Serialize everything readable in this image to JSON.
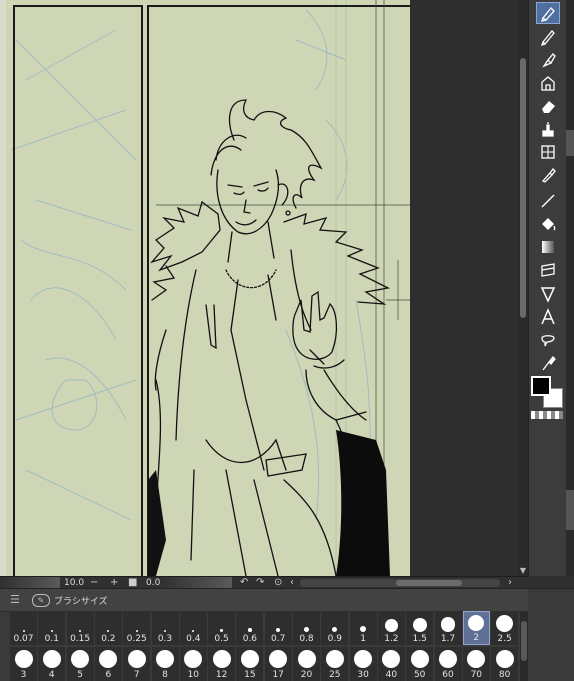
{
  "statusbar": {
    "zoom_value": "10.0",
    "minus_label": "−",
    "plus_label": "+",
    "rotation_value": "0.0",
    "left_arrow": "‹",
    "right_arrow": "›"
  },
  "panel": {
    "menu_glyph": "☰",
    "title": "ブラシサイズ",
    "sizes_row1": [
      "0.07",
      "0.1",
      "0.15",
      "0.2",
      "0.25",
      "0.3",
      "0.4",
      "0.5",
      "0.6",
      "0.7",
      "0.8",
      "0.9",
      "1",
      "1.2",
      "1.5",
      "1.7",
      "2",
      "2.5"
    ],
    "sizes_row2": [
      "3",
      "4",
      "5",
      "6",
      "7",
      "8",
      "10",
      "12",
      "15",
      "17",
      "20",
      "25",
      "30",
      "40",
      "50",
      "60",
      "70",
      "80"
    ],
    "selected_size": "2"
  },
  "tools": [
    {
      "name": "pen-tool",
      "selected": true
    },
    {
      "name": "pencil-tool",
      "selected": false
    },
    {
      "name": "brush-tool",
      "selected": false
    },
    {
      "name": "decoration-tool",
      "selected": false
    },
    {
      "name": "eraser-tool",
      "selected": false
    },
    {
      "name": "blend-tool",
      "selected": false
    },
    {
      "name": "frame-tool",
      "selected": false
    },
    {
      "name": "eyedropper-tool",
      "selected": false
    },
    {
      "name": "line-tool",
      "selected": false
    },
    {
      "name": "fill-tool",
      "selected": false
    },
    {
      "name": "gradient-tool",
      "selected": false
    },
    {
      "name": "ruler-tool",
      "selected": false
    },
    {
      "name": "selection-tool",
      "selected": false
    },
    {
      "name": "text-tool",
      "selected": false
    },
    {
      "name": "balloon-tool",
      "selected": false
    },
    {
      "name": "correct-line-tool",
      "selected": false
    }
  ],
  "colors": {
    "main": "#000000",
    "sub": "#ffffff",
    "canvas_paper": "#cfd6b6",
    "selection_accent": "#5f7195"
  }
}
